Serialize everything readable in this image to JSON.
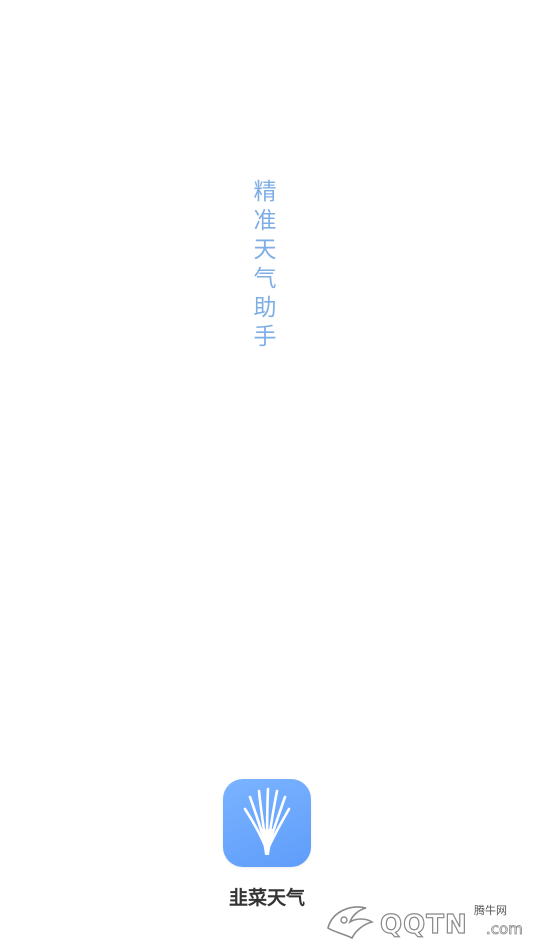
{
  "splash": {
    "tagline": [
      "精",
      "准",
      "天",
      "气",
      "助",
      "手"
    ],
    "app_name": "韭菜天气",
    "accent_color": "#7eaee6",
    "icon_color": "#6ea8fd",
    "icon_name": "leek-icon"
  },
  "watermark": {
    "logo_text": "QQTN",
    "suffix": ".com",
    "cn_label": "腾牛网",
    "icon_name": "qqtn-logo-icon"
  }
}
